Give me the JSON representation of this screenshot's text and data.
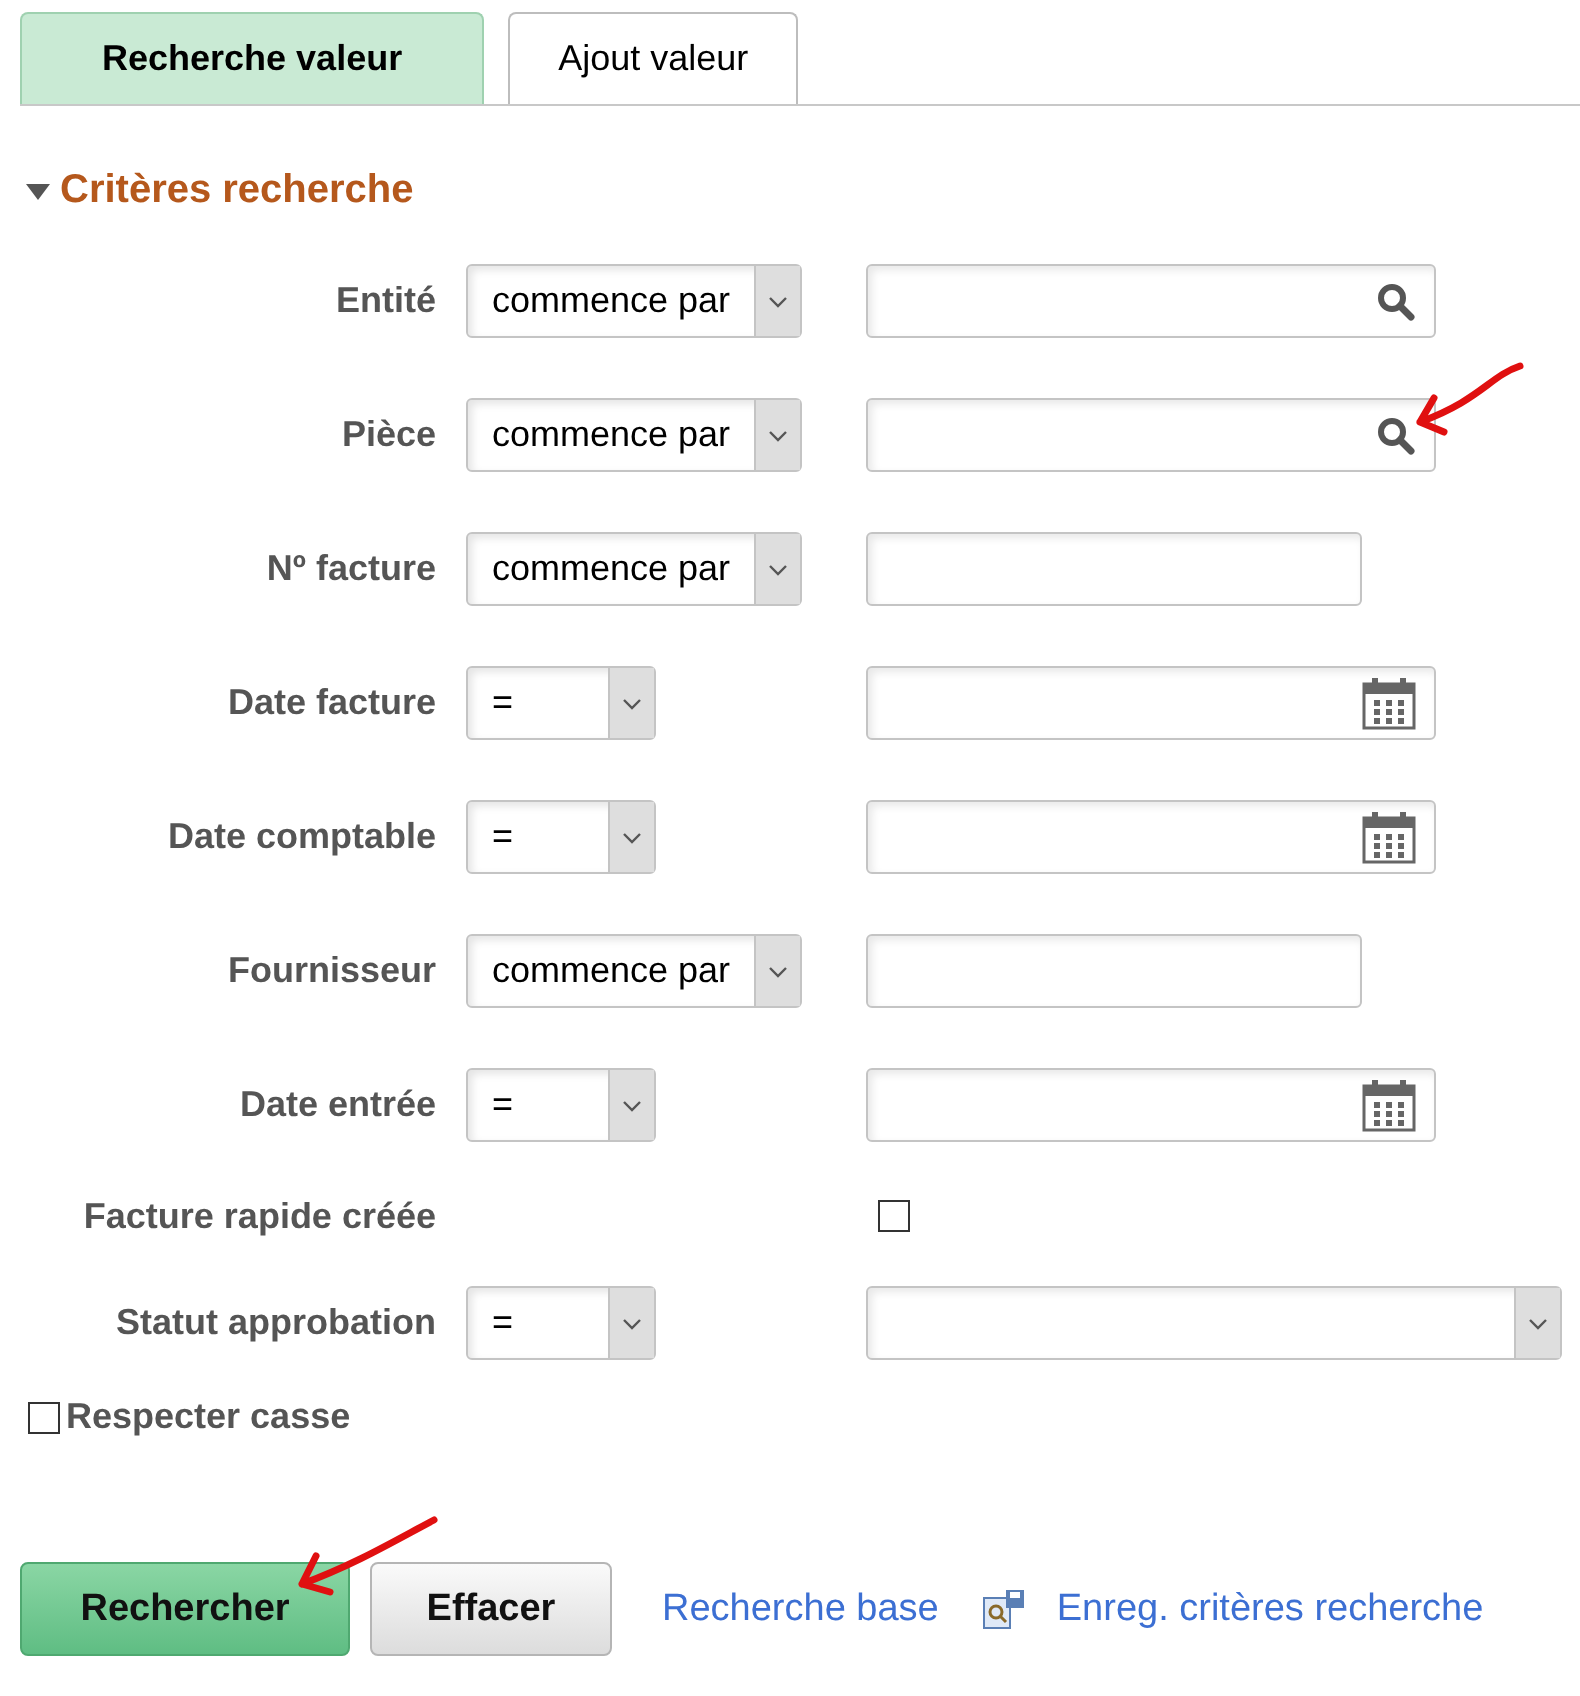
{
  "tabs": [
    {
      "label": "Recherche valeur",
      "selected": true
    },
    {
      "label": "Ajout valeur",
      "selected": false
    }
  ],
  "section": {
    "title": "Critères recherche",
    "expanded": true
  },
  "criteria": [
    {
      "label": "Entité",
      "kind": "lookup",
      "operator": "commence par"
    },
    {
      "label": "Pièce",
      "kind": "lookup",
      "operator": "commence par"
    },
    {
      "label": "Nº facture",
      "kind": "text",
      "operator": "commence par"
    },
    {
      "label": "Date facture",
      "kind": "date",
      "operator": "="
    },
    {
      "label": "Date comptable",
      "kind": "date",
      "operator": "="
    },
    {
      "label": "Fournisseur",
      "kind": "text",
      "operator": "commence par"
    },
    {
      "label": "Date entrée",
      "kind": "date",
      "operator": "="
    },
    {
      "label": "Facture rapide créée",
      "kind": "checkbox",
      "checked": false
    },
    {
      "label": "Statut approbation",
      "kind": "select",
      "operator": "="
    }
  ],
  "case_sensitive": {
    "label": "Respecter casse",
    "checked": false
  },
  "buttons": [
    {
      "label": "Rechercher",
      "kind": "primary"
    },
    {
      "label": "Effacer",
      "kind": "secondary"
    }
  ],
  "links": [
    {
      "label": "Recherche base",
      "icon": false
    },
    {
      "label": "Enreg. critères recherche",
      "icon": true
    }
  ]
}
